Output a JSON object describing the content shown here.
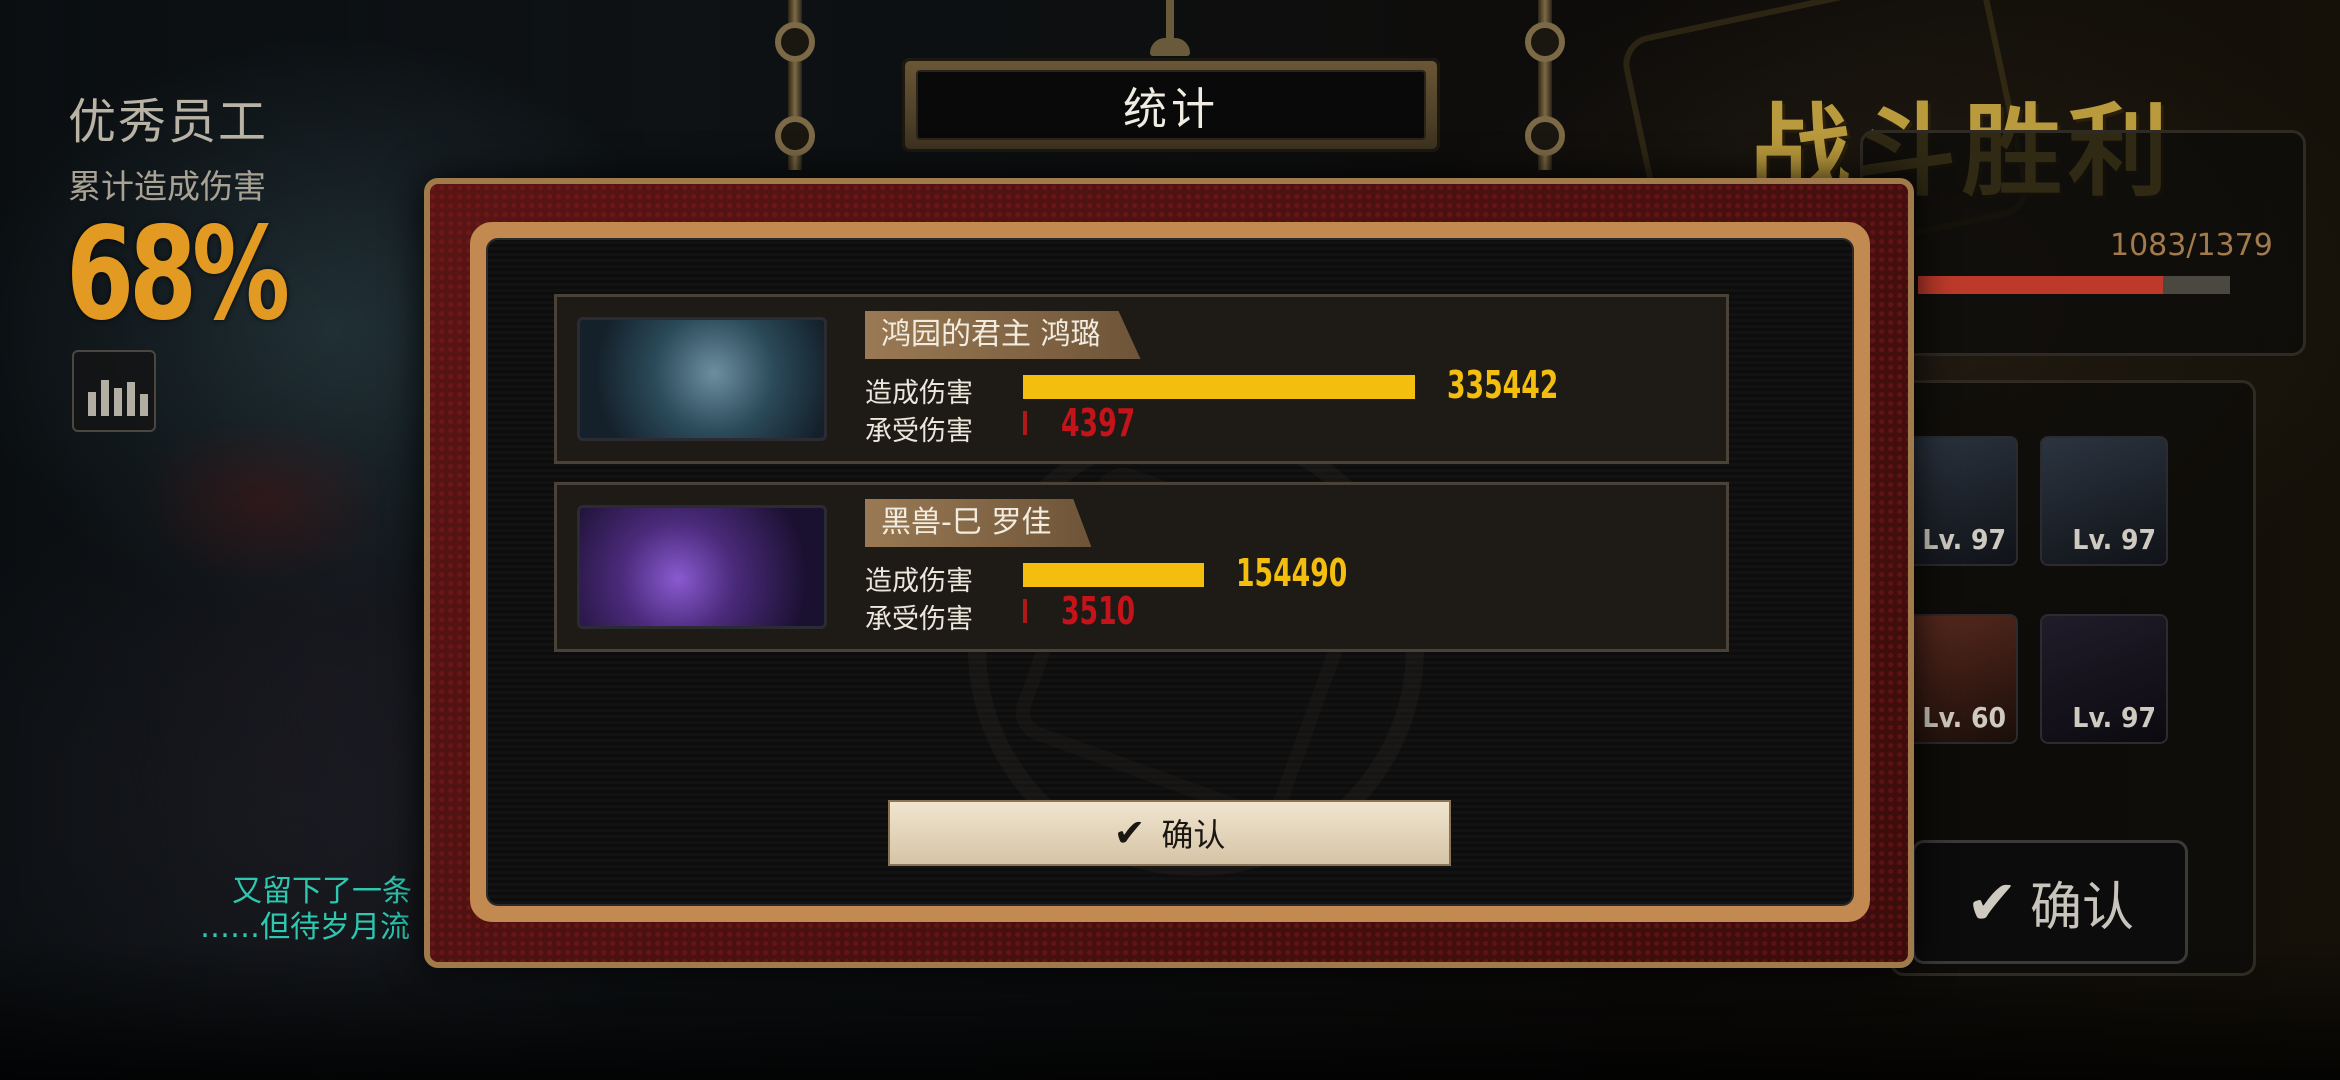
{
  "left_panel": {
    "title": "优秀员工",
    "subtitle": "累计造成伤害",
    "percent": "68%",
    "chart_icon": "bar-chart-icon"
  },
  "quotes": [
    "又留下了一条",
    "……但待岁月流"
  ],
  "dialog": {
    "title": "统计",
    "confirm_label": "确认",
    "confirm_icon": "checkmark-icon",
    "entries": [
      {
        "name": "鸿园的君主 鸿璐",
        "dealt_label": "造成伤害",
        "taken_label": "承受伤害",
        "dealt_value": "335442",
        "taken_value": "4397",
        "dealt_number": 335442,
        "taken_number": 4397
      },
      {
        "name": "黑兽-巳 罗佳",
        "dealt_label": "造成伤害",
        "taken_label": "承受伤害",
        "dealt_value": "154490",
        "taken_value": "3510",
        "dealt_number": 154490,
        "taken_number": 3510
      }
    ]
  },
  "victory": {
    "title": "战斗胜利",
    "exp_text": "1083/1379",
    "exp_current": 1083,
    "exp_max": 1379,
    "party": [
      {
        "level": "Lv. 97"
      },
      {
        "level": "Lv. 97"
      },
      {
        "level": "Lv. 60"
      },
      {
        "level": "Lv. 97"
      }
    ],
    "confirm_label": "确认",
    "confirm_icon": "checkmark-icon"
  },
  "colors": {
    "accent_gold": "#f4be0e",
    "damage_taken_red": "#c4141a",
    "frame_copper": "#c28a50",
    "quote_teal": "#2ec8b0",
    "percent_orange": "#e39a22"
  }
}
